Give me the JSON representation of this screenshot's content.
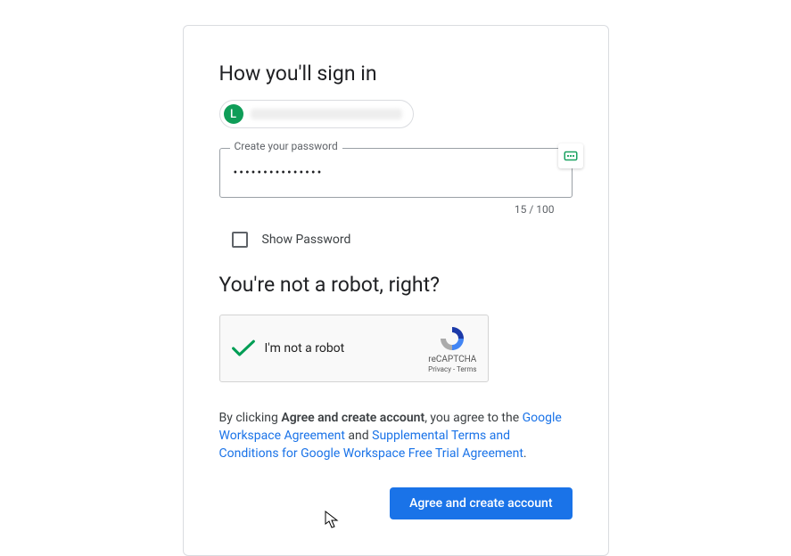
{
  "headings": {
    "signin": "How you'll sign in",
    "robot": "You're not a robot, right?"
  },
  "avatar": {
    "initial": "L"
  },
  "password": {
    "label": "Create your password",
    "masked_value": "•••••••••••••••",
    "counter": "15 / 100"
  },
  "show_password": {
    "label": "Show Password",
    "checked": false
  },
  "recaptcha": {
    "label": "I'm not a robot",
    "brand": "reCAPTCHA",
    "links": "Privacy - Terms",
    "verified": true
  },
  "legal": {
    "prefix": "By clicking ",
    "bold": "Agree and create account",
    "mid1": ", you agree to the ",
    "link1": "Google Workspace Agreement",
    "mid2": " and ",
    "link2": "Supplemental Terms and Conditions for Google Workspace Free Trial Agreement",
    "suffix": "."
  },
  "buttons": {
    "agree": "Agree and create account"
  }
}
